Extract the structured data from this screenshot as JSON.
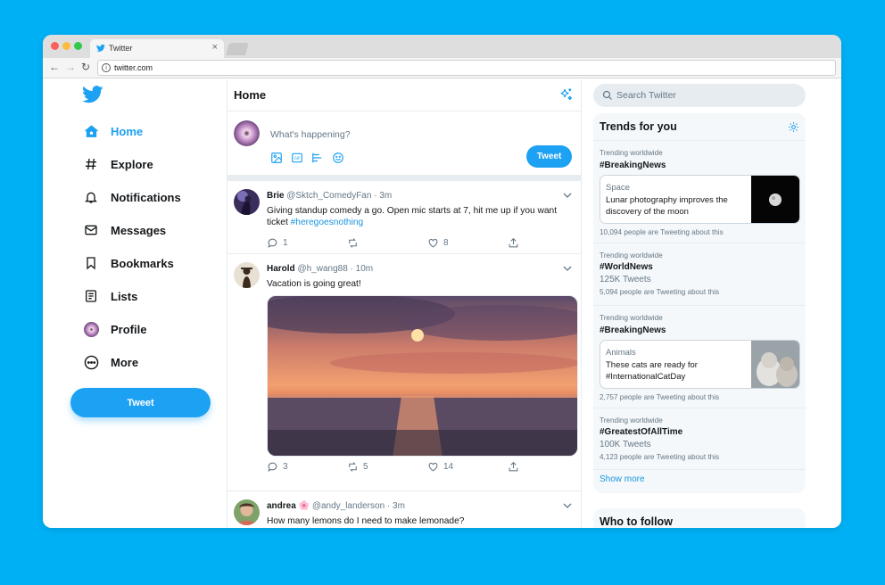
{
  "browser": {
    "tab_title": "Twitter",
    "tab_close": "×",
    "url": "twitter.com"
  },
  "colors": {
    "accent": "#1da1f2",
    "link": "#1b95e0",
    "background": "#00b0f5"
  },
  "sidebar": {
    "items": [
      {
        "label": "Home",
        "icon": "home-icon",
        "active": true
      },
      {
        "label": "Explore",
        "icon": "hashtag-icon"
      },
      {
        "label": "Notifications",
        "icon": "bell-icon"
      },
      {
        "label": "Messages",
        "icon": "envelope-icon"
      },
      {
        "label": "Bookmarks",
        "icon": "bookmark-icon"
      },
      {
        "label": "Lists",
        "icon": "list-icon"
      },
      {
        "label": "Profile",
        "icon": "avatar"
      },
      {
        "label": "More",
        "icon": "more-icon"
      }
    ],
    "tweet_button": "Tweet"
  },
  "main": {
    "title": "Home",
    "compose": {
      "placeholder": "What's happening?",
      "tweet_button": "Tweet"
    },
    "tweets": [
      {
        "name": "Brie",
        "handle": "@Sktch_ComedyFan · 3m",
        "text": "Giving standup comedy a go. Open mic starts at 7, hit me up if you want ticket ",
        "hashtag": "#heregoesnothing",
        "replies": "1",
        "retweets": "",
        "likes": "8"
      },
      {
        "name": "Harold",
        "handle": "@h_wang88 · 10m",
        "text": "Vacation is going great!",
        "replies": "3",
        "retweets": "5",
        "likes": "14"
      },
      {
        "name": "andrea",
        "emoji": "🌸",
        "handle": "@andy_landerson · 3m",
        "text": "How many lemons do I need to make lemonade?"
      }
    ]
  },
  "right": {
    "search_placeholder": "Search Twitter",
    "trends_title": "Trends for you",
    "trends": [
      {
        "meta": "Trending worldwide",
        "tag": "#BreakingNews",
        "card": {
          "category": "Space",
          "headline": "Lunar photography improves the discovery of the moon"
        },
        "sub": "10,094 people are Tweeting about this"
      },
      {
        "meta": "Trending worldwide",
        "tag": "#WorldNews",
        "count": "125K Tweets",
        "sub": "5,094 people are Tweeting about this"
      },
      {
        "meta": "Trending worldwide",
        "tag": "#BreakingNews",
        "card": {
          "category": "Animals",
          "headline": "These cats are ready for #InternationalCatDay"
        },
        "sub": "2,757 people are Tweeting about this"
      },
      {
        "meta": "Trending worldwide",
        "tag": "#GreatestOfAllTime",
        "count": "100K Tweets",
        "sub": "4,123 people are Tweeting about this"
      }
    ],
    "show_more": "Show more",
    "who_to_follow": "Who to follow"
  }
}
